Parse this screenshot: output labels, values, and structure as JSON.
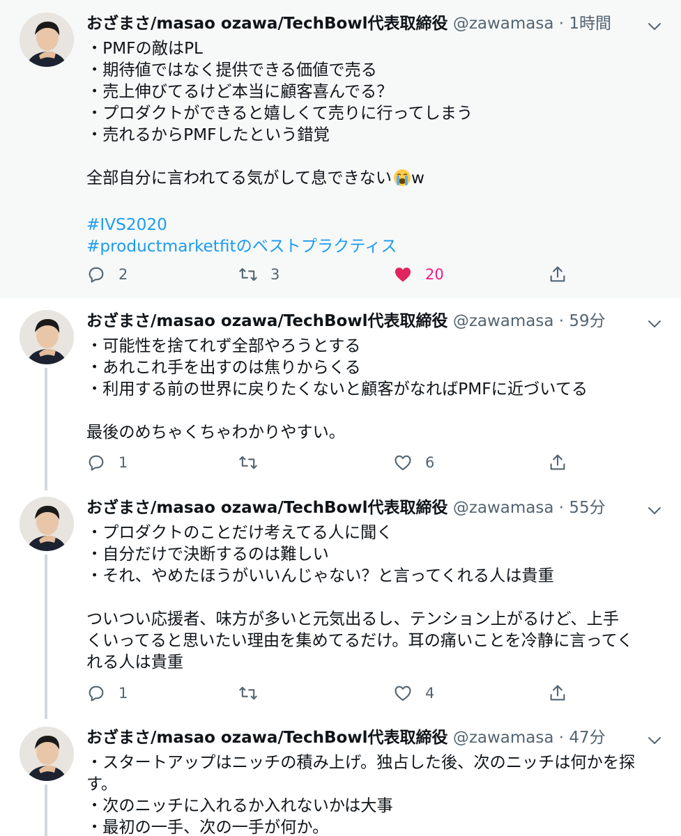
{
  "tweets": [
    {
      "name": "おざまさ/masao ozawa/TechBowl代表取締役",
      "handle": "@zawamasa",
      "dot": "·",
      "time": "1時間",
      "lines": [
        "・PMFの敵はPL",
        "・期待値ではなく提供できる価値で売る",
        "・売上伸びてるけど本当に顧客喜んでる？",
        "・プロダクトができると嬉しくて売りに行ってしまう",
        "・売れるからPMFしたという錯覚"
      ],
      "line2": "全部自分に言われてる気がして息できない",
      "line2_suffix": "w",
      "emoji": "crying-face-emoji",
      "hashtags": [
        "#IVS2020",
        "#productmarketfitのベストプラクティス"
      ],
      "replies": "2",
      "retweets": "3",
      "likes": "20",
      "liked": true
    },
    {
      "name": "おざまさ/masao ozawa/TechBowl代表取締役",
      "handle": "@zawamasa",
      "dot": "·",
      "time": "59分",
      "lines": [
        "・可能性を捨てれず全部やろうとする",
        "・あれこれ手を出すのは焦りからくる",
        "・利用する前の世界に戻りたくないと顧客がなればPMFに近づいてる"
      ],
      "line2": "最後のめちゃくちゃわかりやすい。",
      "replies": "1",
      "retweets": "",
      "likes": "6"
    },
    {
      "name": "おざまさ/masao ozawa/TechBowl代表取締役",
      "handle": "@zawamasa",
      "dot": "·",
      "time": "55分",
      "lines": [
        "・プロダクトのことだけ考えてる人に聞く",
        "・自分だけで決断するのは難しい",
        "・それ、やめたほうがいいんじゃない？と言ってくれる人は貴重"
      ],
      "para": [
        "ついつい応援者、味方が多いと元気出るし、テンション上がるけど、上手",
        "くいってると思いたい理由を集めてるだけ。耳の痛いことを冷静に言ってく",
        "れる人は貴重"
      ],
      "replies": "1",
      "retweets": "",
      "likes": "4"
    },
    {
      "name": "おざまさ/masao ozawa/TechBowl代表取締役",
      "handle": "@zawamasa",
      "dot": "·",
      "time": "47分",
      "lines": [
        "・スタートアップはニッチの積み上げ。独占した後、次のニッチは何かを探",
        "す。",
        "・次のニッチに入れるか入れないかは大事",
        "・最初の一手、次の一手が何か。"
      ]
    }
  ],
  "colors": {
    "accent": "#1d9bf0",
    "like": "#f91880",
    "muted": "#536471",
    "text": "#0f1419",
    "highlight_bg": "#f7f9f9"
  }
}
